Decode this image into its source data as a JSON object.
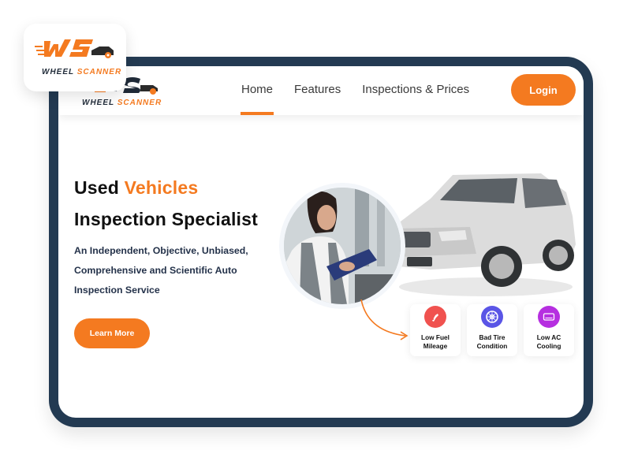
{
  "brand": {
    "logo_mark": "WS",
    "name_part1": "WHEEL",
    "name_part2": "SCANNER"
  },
  "nav": {
    "items": [
      {
        "label": "Home",
        "active": true
      },
      {
        "label": "Features",
        "active": false
      },
      {
        "label": "Inspections & Prices",
        "active": false
      }
    ],
    "login_label": "Login"
  },
  "hero": {
    "title_part1": "Used ",
    "title_accent": "Vehicles",
    "title_line2": "Inspection Specialist",
    "subtitle_line1": "An Independent, Objective, Unbiased,",
    "subtitle_line2": "Comprehensive and Scientific Auto",
    "subtitle_line3": "Inspection Service",
    "cta_label": "Learn More"
  },
  "features": [
    {
      "line1": "Low Fuel",
      "line2": "Mileage",
      "icon": "fuel-pump-icon",
      "color": "#f0524f"
    },
    {
      "line1": "Bad Tire",
      "line2": "Condition",
      "icon": "tire-icon",
      "color": "#5a55e6"
    },
    {
      "line1": "Low AC",
      "line2": "Cooling",
      "icon": "ac-unit-icon",
      "color": "#b62fe0"
    }
  ],
  "colors": {
    "accent": "#f47a20",
    "frame": "#233a52",
    "text_dark": "#24324a"
  }
}
